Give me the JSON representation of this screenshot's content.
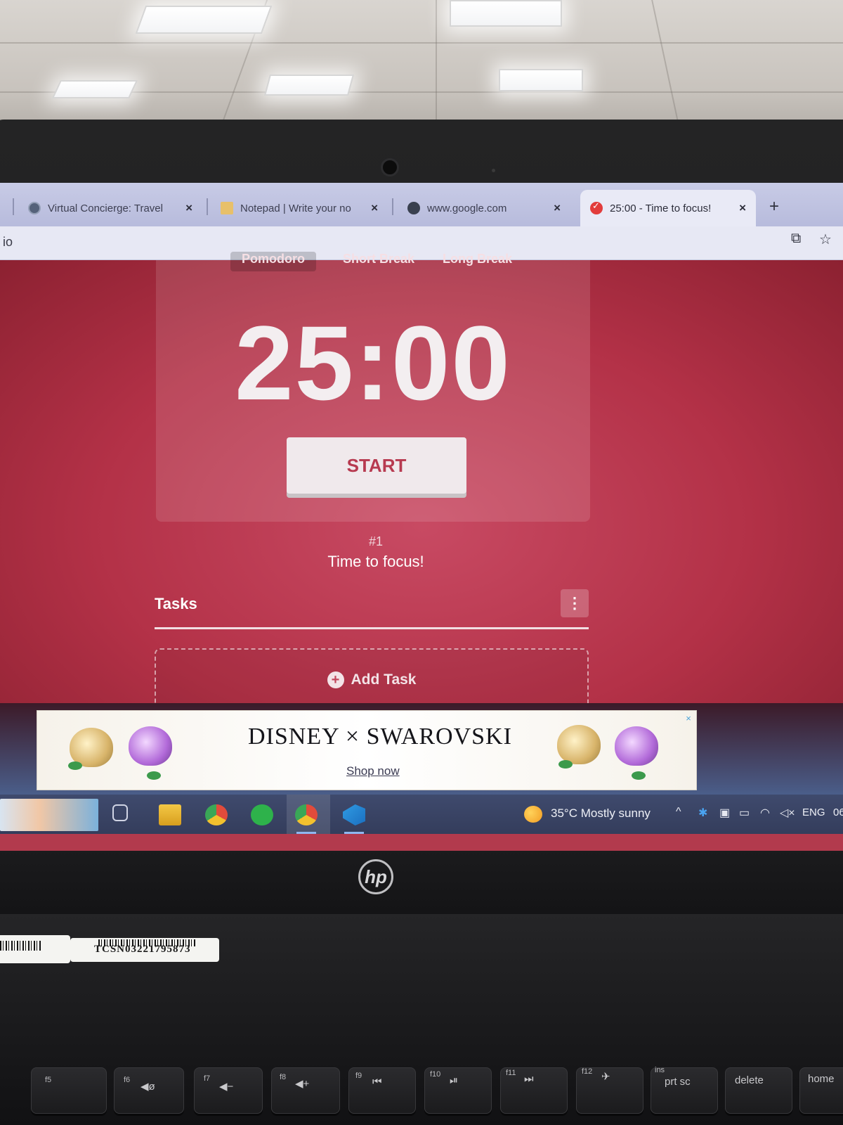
{
  "browser": {
    "tabs": [
      {
        "title": "Virtual Concierge: Travel",
        "icon": "chatgpt-icon"
      },
      {
        "title": "Notepad | Write your no",
        "icon": "notepad-icon"
      },
      {
        "title": "www.google.com",
        "icon": "globe-icon"
      },
      {
        "title": "25:00 - Time to focus!",
        "icon": "tomato-check-icon",
        "active": true
      }
    ],
    "tab_close": "×",
    "new_tab": "+",
    "url_fragment": "io"
  },
  "app": {
    "mode_tabs": [
      "Pomodoro",
      "Short Break",
      "Long Break"
    ],
    "timer": "25:00",
    "start_label": "START",
    "session_number": "#1",
    "session_message": "Time to focus!",
    "tasks_title": "Tasks",
    "tasks_menu": "⋮",
    "add_task_label": "Add Task",
    "colors": {
      "background": "#b33147",
      "accent": "#b73a50"
    }
  },
  "ad": {
    "title": "DISNEY × SWAROVSKI",
    "cta": "Shop now",
    "close": "×"
  },
  "taskbar": {
    "weather": "35°C  Mostly sunny",
    "language": "ENG",
    "clock_fragment": "06",
    "tray_chevron": "^"
  },
  "laptop": {
    "brand": "hp",
    "sticker_serial": "TCSN03221795873",
    "keys": [
      "f5",
      "f6",
      "f7",
      "f8",
      "f9",
      "f10",
      "f11",
      "f12",
      "prt sc",
      "delete",
      "home"
    ],
    "ins_label": "ins"
  }
}
